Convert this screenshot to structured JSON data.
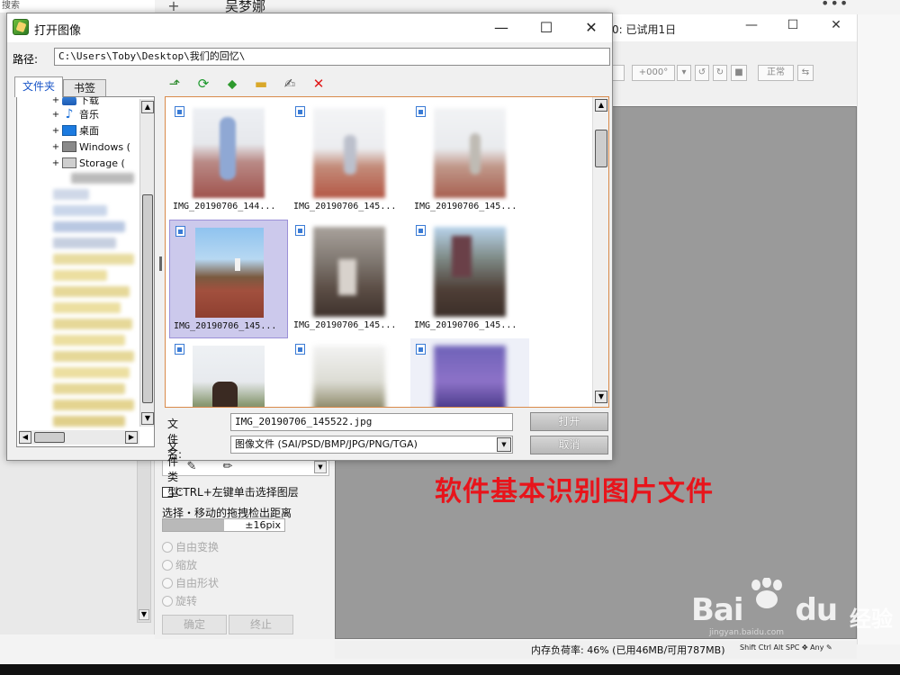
{
  "background_app": {
    "search_label": "搜索",
    "author": "吴梦娜",
    "window_title": "0: 已试用1日",
    "rotation_value": "+000°",
    "normal_button": "正常",
    "caption": "软件基本识别图片文件",
    "status_memory": "内存负荷率: 46% (已用46MB/可用787MB)",
    "status_keys": "Shift Ctrl Alt SPC ✥ Any ✎",
    "tool_panel": {
      "ctrl_check_label": "CTRL+左键单击选择图层",
      "drag_label": "选择・移动的拖拽检出距离",
      "drag_value": "±16pix",
      "drag_fraction": 0.5,
      "radios": [
        "自由变换",
        "缩放",
        "自由形状",
        "旋转"
      ],
      "ok_button": "确定",
      "stop_button": "终止"
    }
  },
  "dialog": {
    "title": "打开图像",
    "path_label": "路径:",
    "path_value": "C:\\Users\\Toby\\Desktop\\我们的回忆\\",
    "tabs": [
      "文件夹",
      "书签"
    ],
    "tree_items": [
      {
        "label": "下载",
        "icon": "download-folder-icon"
      },
      {
        "label": "音乐",
        "icon": "music-folder-icon"
      },
      {
        "label": "桌面",
        "icon": "desktop-folder-icon"
      },
      {
        "label": "Windows (",
        "icon": "windows-drive-icon"
      },
      {
        "label": "Storage (",
        "icon": "storage-drive-icon"
      }
    ],
    "thumbnails": [
      {
        "name": "IMG_20190706_144..."
      },
      {
        "name": "IMG_20190706_145..."
      },
      {
        "name": "IMG_20190706_145..."
      },
      {
        "name": "IMG_20190706_145...",
        "selected": true
      },
      {
        "name": "IMG_20190706_145..."
      },
      {
        "name": "IMG_20190706_145..."
      },
      {
        "name": ""
      },
      {
        "name": ""
      },
      {
        "name": ""
      }
    ],
    "filename_label": "文件名:",
    "filename_value": "IMG_20190706_145522.jpg",
    "filetype_label": "文件类型:",
    "filetype_value": "图像文件 (SAI/PSD/BMP/JPG/PNG/TGA)",
    "open_button": "打开",
    "cancel_button": "取消"
  },
  "watermark": {
    "brand": "Bai",
    "brand2": "du",
    "suffix": "经验",
    "url": "jingyan.baidu.com"
  }
}
